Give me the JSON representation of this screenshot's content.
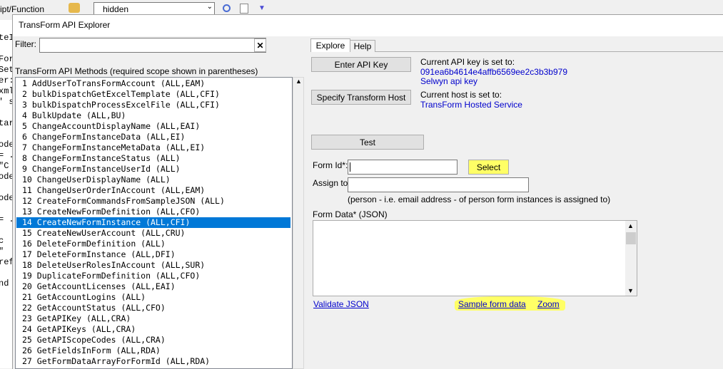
{
  "background": {
    "script_label": "ipt/Function",
    "dropdown_value": "hidden",
    "left_code": [
      "teI",
      "",
      "For",
      "Set",
      "er:",
      "xml",
      "' s",
      "",
      "tar",
      "",
      "ode",
      "= .",
      "\"C",
      "ode",
      "",
      "ode",
      "",
      "= .",
      "",
      "c",
      "\"",
      "ref",
      "",
      "nd"
    ]
  },
  "window": {
    "title": "TransForm API Explorer"
  },
  "filter": {
    "label": "Filter:",
    "value": "",
    "clear_glyph": "✕"
  },
  "methods": {
    "heading": "TransForm API Methods (required scope shown in parentheses)",
    "selected_index": 13,
    "items": [
      "1 AddUserToTransFormAccount (ALL,EAM)",
      "2 bulkDispatchGetExcelTemplate (ALL,CFI)",
      "3 bulkDispatchProcessExcelFile (ALL,CFI)",
      "4 BulkUpdate (ALL,BU)",
      "5 ChangeAccountDisplayName (ALL,EAI)",
      "6 ChangeFormInstanceData (ALL,EI)",
      "7 ChangeFormInstanceMetaData (ALL,EI)",
      "8 ChangeFormInstanceStatus (ALL)",
      "9 ChangeFormInstanceUserId (ALL)",
      "10 ChangeUserDisplayName (ALL)",
      "11 ChangeUserOrderInAccount (ALL,EAM)",
      "12 CreateFormCommandsFromSampleJSON (ALL)",
      "13 CreateNewFormDefinition (ALL,CFO)",
      "14 CreateNewFormInstance (ALL,CFI)",
      "15 CreateNewUserAccount (ALL,CRU)",
      "16 DeleteFormDefinition (ALL)",
      "17 DeleteFormInstance (ALL,DFI)",
      "18 DeleteUserRolesInAccount (ALL,SUR)",
      "19 DuplicateFormDefinition (ALL,CFO)",
      "20 GetAccountLicenses (ALL,EAI)",
      "21 GetAccountLogins (ALL)",
      "22 GetAccountStatus (ALL,CFO)",
      "23 GetAPIKey (ALL,CRA)",
      "24 GetAPIKeys (ALL,CRA)",
      "25 GetAPIScopeCodes (ALL,CRA)",
      "26 GetFieldsInForm (ALL,RDA)",
      "27 GetFormDataArrayForFormId (ALL,RDA)"
    ]
  },
  "tabs": {
    "explore": "Explore",
    "help": "Help"
  },
  "api_key": {
    "button": "Enter API Key",
    "status": "Current API key is set to:",
    "value": "091ea6b4614e4affb6569ee2c3b3b979",
    "name": "Selwyn api key"
  },
  "host": {
    "button": "Specify Transform Host",
    "status": "Current host is set to:",
    "value": "TransForm Hosted Service"
  },
  "test_button": "Test",
  "form_id": {
    "label": "Form Id*:",
    "value": "",
    "select_button": "Select"
  },
  "assign_to": {
    "label": "Assign to:",
    "value": "",
    "hint": "(person - i.e. email address - of person form instances is assigned to)"
  },
  "form_data": {
    "label": "Form Data* (JSON)",
    "value": ""
  },
  "links": {
    "validate": "Validate JSON",
    "sample": "Sample form data",
    "zoom": "Zoom"
  },
  "colors": {
    "selection": "#0078d7",
    "link": "#0000cc",
    "highlight": "#ffff66"
  }
}
